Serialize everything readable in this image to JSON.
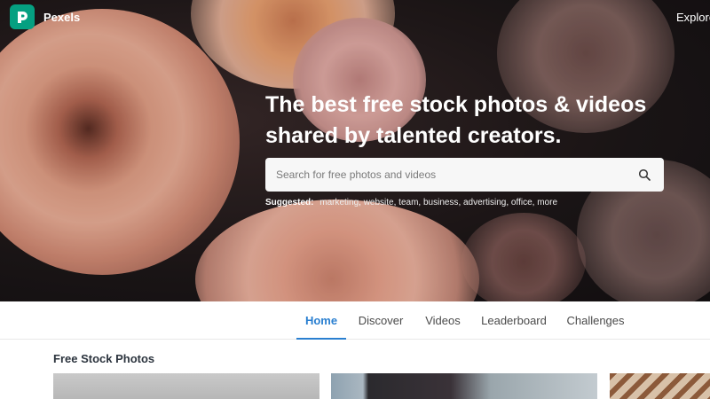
{
  "app": {
    "name": "Pexels",
    "logo_icon": "pexels-logo-icon",
    "brand_color": "#05a081"
  },
  "header": {
    "explore_label": "Explore"
  },
  "hero": {
    "headline": "The best free stock photos & videos shared by talented creators.",
    "search": {
      "placeholder": "Search for free photos and videos",
      "value": "",
      "icon": "search-icon"
    },
    "suggested": {
      "label": "Suggested:",
      "tags": [
        "marketing",
        "website",
        "team",
        "business",
        "advertising",
        "office",
        "more"
      ]
    }
  },
  "nav": {
    "tabs": [
      {
        "label": "Home",
        "active": true
      },
      {
        "label": "Discover",
        "active": false
      },
      {
        "label": "Videos",
        "active": false
      },
      {
        "label": "Leaderboard",
        "active": false
      },
      {
        "label": "Challenges",
        "active": false
      }
    ],
    "accent_color": "#2a7fd0"
  },
  "main": {
    "section_title": "Free Stock Photos"
  }
}
